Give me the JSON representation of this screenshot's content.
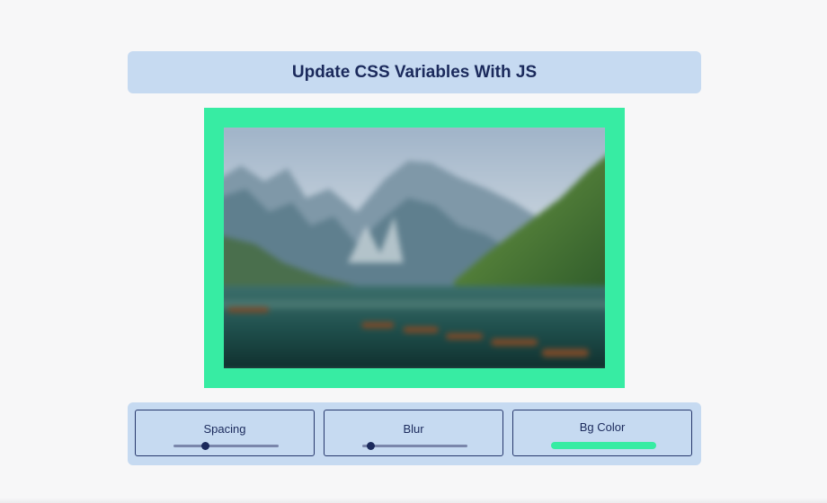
{
  "header": {
    "title": "Update CSS Variables With JS"
  },
  "image": {
    "description_icon": "landscape-photo",
    "blur_level": 0.3
  },
  "controls": [
    {
      "label": "Spacing",
      "type": "range",
      "value_fraction": 0.3
    },
    {
      "label": "Blur",
      "type": "range",
      "value_fraction": 0.08
    },
    {
      "label": "Bg Color",
      "type": "color",
      "value": "#37eca3"
    }
  ],
  "colors": {
    "accent": "#37eca3",
    "panel": "#c6daf1",
    "text": "#1b2a5c"
  }
}
